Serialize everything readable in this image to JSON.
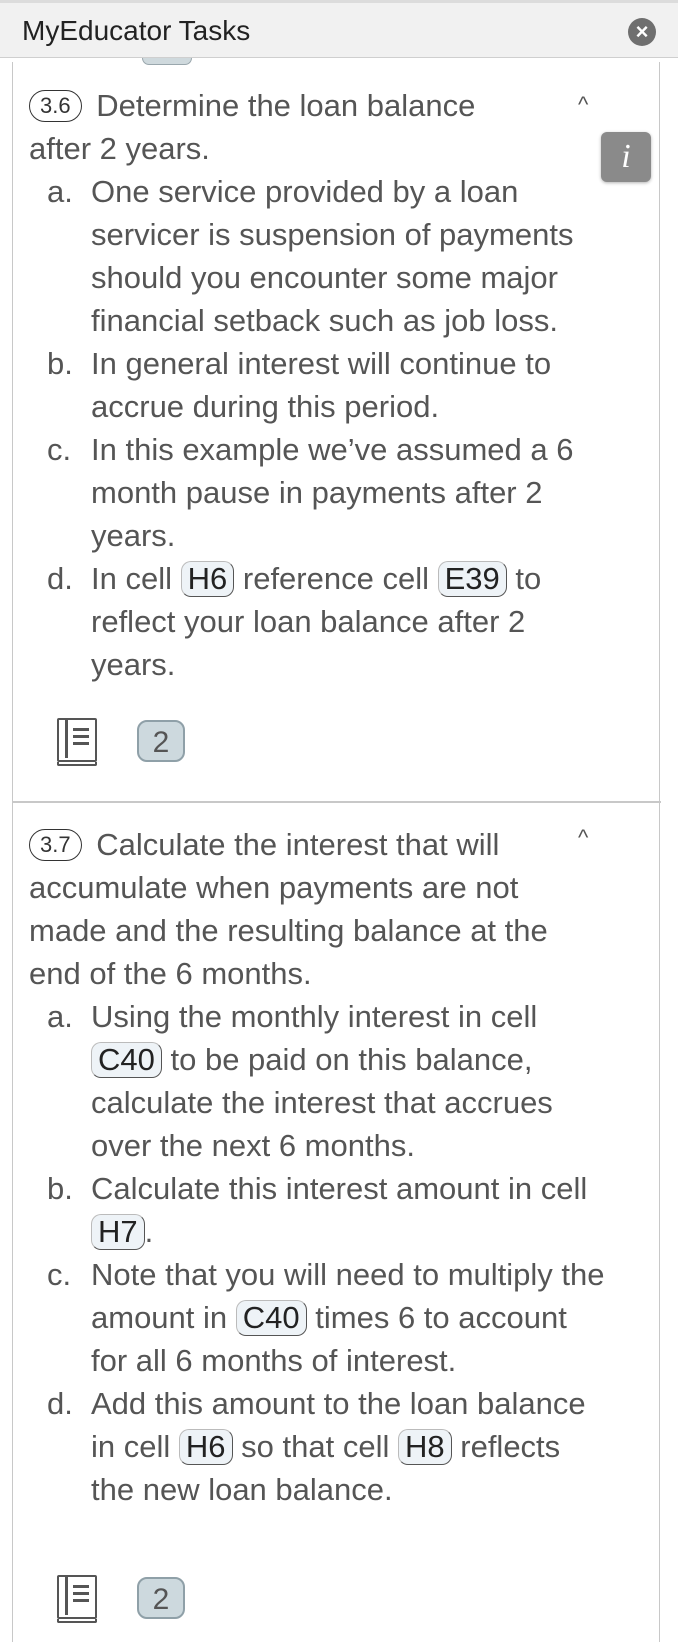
{
  "window": {
    "title": "MyEducator Tasks",
    "close_icon": "close-icon"
  },
  "tasks": [
    {
      "number": "3.6",
      "title_first": "Determine the loan balance",
      "title_rest": "after 2 years.",
      "steps": [
        {
          "label": "a.",
          "text": "One service provided by a loan servicer is suspension of payments should you encounter some major financial setback such as job loss."
        },
        {
          "label": "b.",
          "text": "In general interest will continue to accrue during this period."
        },
        {
          "label": "c.",
          "text": "In this example we’ve assumed a 6 month pause in payments after 2 years."
        },
        {
          "label": "d.",
          "parts": [
            "In cell",
            "H6",
            "reference cell",
            "E39",
            "to reflect your loan balance after 2 years."
          ]
        }
      ],
      "resource_count": "2"
    },
    {
      "number": "3.7",
      "title_first": "Calculate the interest that will",
      "title_rest": "accumulate when payments are not made and the resulting balance at the end of the 6 months.",
      "steps": [
        {
          "label": "a.",
          "parts": [
            "Using the monthly interest in cell",
            "C40",
            "to be paid on this balance, calculate the interest that accrues over the next 6 months."
          ]
        },
        {
          "label": "b.",
          "parts": [
            "Calculate this interest amount in cell",
            "H7",
            "."
          ]
        },
        {
          "label": "c.",
          "parts": [
            "Note that you will need to multiply the amount in",
            "C40",
            "times 6 to account for all 6 months of interest."
          ]
        },
        {
          "label": "d.",
          "parts": [
            "Add this amount to the loan balance in cell",
            "H6",
            "so that cell",
            "H8",
            "reflects the new loan balance."
          ]
        }
      ],
      "resource_count": "2"
    }
  ],
  "info_button": {
    "label": "i"
  },
  "colors": {
    "cell_bg": "#eef3f7",
    "badge_bg": "#cdd9de",
    "info_bg": "#8a8a8a"
  }
}
